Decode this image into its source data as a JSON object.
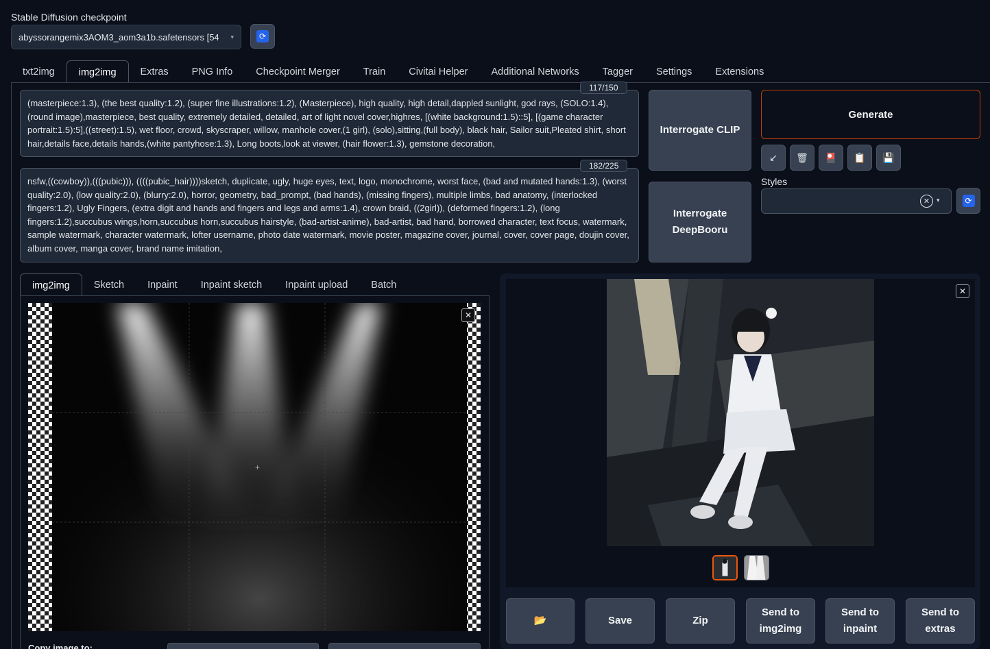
{
  "checkpoint": {
    "label": "Stable Diffusion checkpoint",
    "value": "abyssorangemix3AOM3_aom3a1b.safetensors [54",
    "refresh_icon": "refresh-icon"
  },
  "tabs": [
    "txt2img",
    "img2img",
    "Extras",
    "PNG Info",
    "Checkpoint Merger",
    "Train",
    "Civitai Helper",
    "Additional Networks",
    "Tagger",
    "Settings",
    "Extensions"
  ],
  "active_tab": "img2img",
  "prompt": {
    "counter": "117/150",
    "text": "(masterpiece:1.3), (the best quality:1.2), (super fine illustrations:1.2), (Masterpiece), high quality, high detail,dappled sunlight, god rays, (SOLO:1.4), (round image),masterpiece, best quality, extremely detailed, detailed, art of light novel cover,highres, [(white background:1.5)::5], [(game character portrait:1.5):5],((street):1.5), wet floor, crowd, skyscraper, willow, manhole cover,(1 girl), (solo),sitting,(full body), black hair, Sailor suit,Pleated shirt, short hair,details face,details hands,(white pantyhose:1.3), Long boots,look at viewer, (hair flower:1.3), gemstone decoration,"
  },
  "negative_prompt": {
    "counter": "182/225",
    "text": "nsfw,((cowboy)),(((pubic))), ((((pubic_hair))))sketch, duplicate, ugly, huge eyes, text, logo, monochrome, worst face, (bad and mutated hands:1.3), (worst quality:2.0), (low quality:2.0), (blurry:2.0), horror, geometry, bad_prompt, (bad hands), (missing fingers), multiple limbs, bad anatomy, (interlocked fingers:1.2), Ugly Fingers, (extra digit and hands and fingers and legs and arms:1.4), crown braid, ((2girl)), (deformed fingers:1.2), (long fingers:1.2),succubus wings,horn,succubus horn,succubus hairstyle, (bad-artist-anime), bad-artist, bad hand, borrowed character, text focus, watermark, sample watermark, character watermark, lofter username, photo date watermark, movie poster, magazine cover, journal, cover, cover page, doujin cover, album cover, manga cover, brand name imitation,"
  },
  "interrogate_clip": "Interrogate CLIP",
  "interrogate_deepbooru": "Interrogate DeepBooru",
  "generate": "Generate",
  "tool_icons": [
    "arrow-down-left-icon",
    "trash-icon",
    "red-card-icon",
    "clipboard-icon",
    "save-disk-icon"
  ],
  "tool_glyphs": [
    "↙",
    "🗑",
    "🎴",
    "📋",
    "💾"
  ],
  "styles": {
    "label": "Styles",
    "value": ""
  },
  "sub_tabs": [
    "img2img",
    "Sketch",
    "Inpaint",
    "Inpaint sketch",
    "Inpaint upload",
    "Batch"
  ],
  "active_sub_tab": "img2img",
  "gallery_actions": {
    "folder": "📂",
    "save": "Save",
    "zip": "Zip",
    "send_img2img": "Send to img2img",
    "send_inpaint": "Send to inpaint",
    "send_extras": "Send to extras"
  },
  "copy_label": "Copy image to:",
  "colors": {
    "accent": "#ea580c",
    "refresh": "#2563eb",
    "bg": "#0b0f19",
    "panel": "#1f2937"
  }
}
